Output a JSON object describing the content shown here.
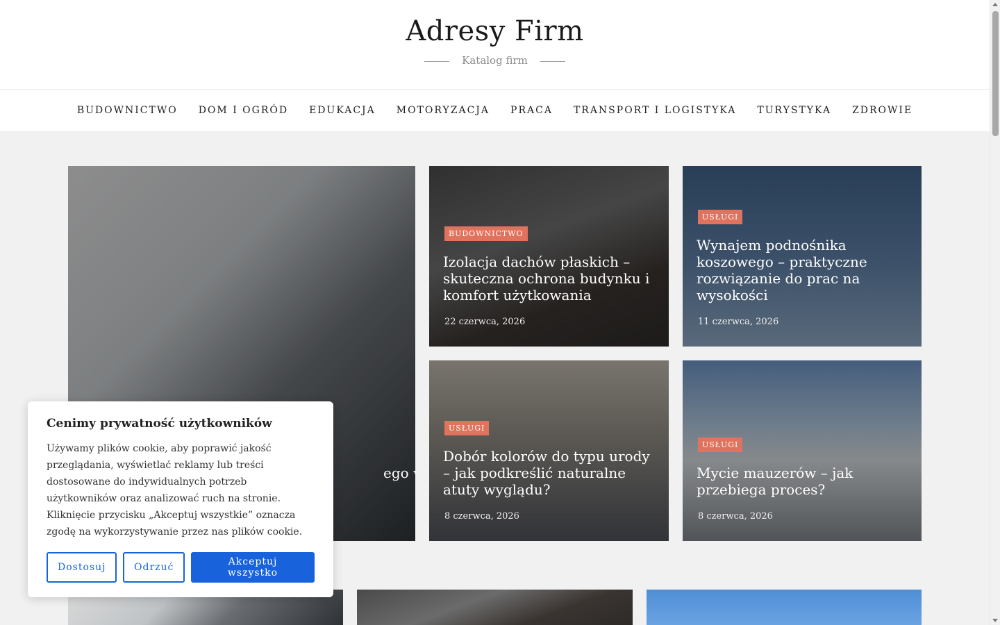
{
  "site": {
    "title": "Adresy Firm",
    "tagline": "Katalog firm"
  },
  "nav": {
    "items": [
      {
        "label": "BUDOWNICTWO"
      },
      {
        "label": "DOM I OGRÓD"
      },
      {
        "label": "EDUKACJA"
      },
      {
        "label": "MOTORYZACJA"
      },
      {
        "label": "PRACA"
      },
      {
        "label": "TRANSPORT I LOGISTYKA"
      },
      {
        "label": "TURYSTYKA"
      },
      {
        "label": "ZDROWIE"
      }
    ]
  },
  "featured": {
    "big": {
      "title_fragment": "ego warto"
    },
    "posts": [
      {
        "category": "BUDOWNICTWO",
        "title": "Izolacja dachów płaskich – skuteczna ochrona budynku i komfort użytkowania",
        "date": "22 czerwca, 2026"
      },
      {
        "category": "USŁUGI",
        "title": "Wynajem podnośnika koszowego – praktyczne rozwiązanie do prac na wysokości",
        "date": "11 czerwca, 2026"
      },
      {
        "category": "USŁUGI",
        "title": "Dobór kolorów do typu urody – jak podkreślić naturalne atuty wyglądu?",
        "date": "8 czerwca, 2026"
      },
      {
        "category": "USŁUGI",
        "title": "Mycie mauzerów – jak przebiega proces?",
        "date": "8 czerwca, 2026"
      }
    ]
  },
  "cookie": {
    "title": "Cenimy prywatność użytkowników",
    "text": "Używamy plików cookie, aby poprawić jakość przeglądania, wyświetlać reklamy lub treści dostosowane do indywidualnych potrzeb użytkowników oraz analizować ruch na stronie. Kliknięcie przycisku „Akceptuj wszystkie” oznacza zgodę na wykorzystywanie przez nas plików cookie.",
    "customize_label": "Dostosuj",
    "reject_label": "Odrzuć",
    "accept_label": "Akceptuj wszystko"
  },
  "colors": {
    "accent_badge": "#e0735d",
    "cookie_button": "#1863dc"
  }
}
